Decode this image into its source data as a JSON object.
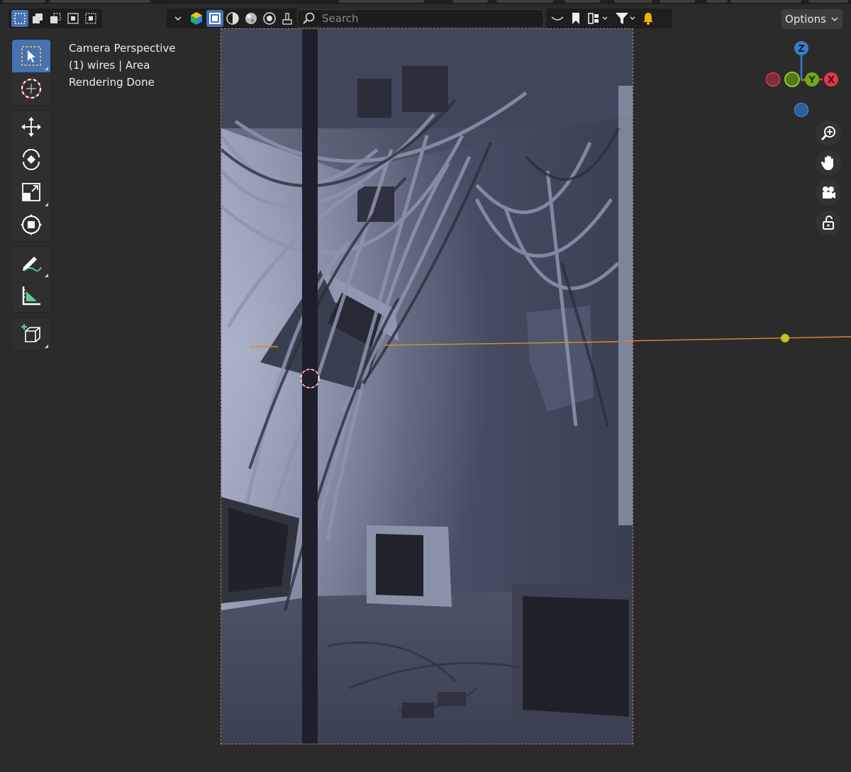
{
  "header": {
    "search_placeholder": "Search",
    "options_label": "Options"
  },
  "overlay": {
    "view_name": "Camera Perspective",
    "object_info": "(1) wires | Area",
    "render_status": "Rendering Done"
  },
  "gizmo": {
    "z_label": "Z",
    "y_label": "Y",
    "x_label": "X"
  },
  "colors": {
    "accent": "#4772b3",
    "x_axis": "#e2374d",
    "y_axis": "#74a81d",
    "z_axis": "#3b7bd0",
    "light_line": "#e08a2e"
  }
}
